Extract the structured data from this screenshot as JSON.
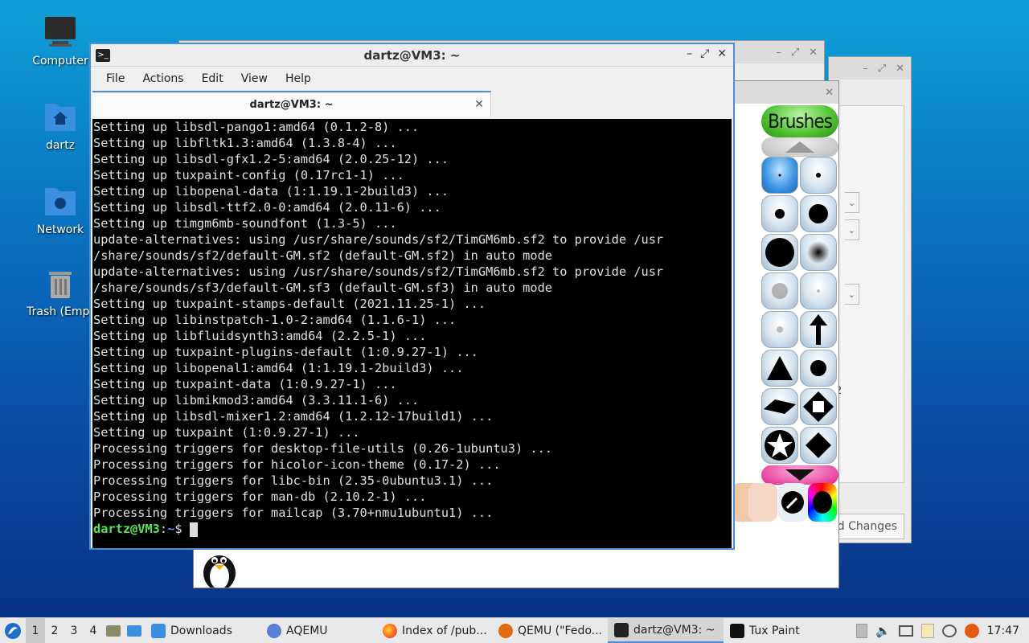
{
  "desktop": {
    "icons": [
      {
        "label": "Computer"
      },
      {
        "label": "dartz"
      },
      {
        "label": "Network"
      },
      {
        "label": "Trash (Empt"
      }
    ]
  },
  "background_window": {
    "button_label_fragment": "rd Changes",
    "digit_fragment": "2"
  },
  "tuxpaint": {
    "title": "Tux Paint",
    "brushes_label": "Brushes"
  },
  "terminal": {
    "title": "dartz@VM3: ~",
    "menu": [
      "File",
      "Actions",
      "Edit",
      "View",
      "Help"
    ],
    "tab_label": "dartz@VM3: ~",
    "lines": [
      "Setting up libsdl-pango1:amd64 (0.1.2-8) ...",
      "Setting up libfltk1.3:amd64 (1.3.8-4) ...",
      "Setting up libsdl-gfx1.2-5:amd64 (2.0.25-12) ...",
      "Setting up tuxpaint-config (0.17rc1-1) ...",
      "Setting up libopenal-data (1:1.19.1-2build3) ...",
      "Setting up libsdl-ttf2.0-0:amd64 (2.0.11-6) ...",
      "Setting up timgm6mb-soundfont (1.3-5) ...",
      "update-alternatives: using /usr/share/sounds/sf2/TimGM6mb.sf2 to provide /usr",
      "/share/sounds/sf2/default-GM.sf2 (default-GM.sf2) in auto mode",
      "update-alternatives: using /usr/share/sounds/sf2/TimGM6mb.sf2 to provide /usr",
      "/share/sounds/sf3/default-GM.sf3 (default-GM.sf3) in auto mode",
      "Setting up tuxpaint-stamps-default (2021.11.25-1) ...",
      "Setting up libinstpatch-1.0-2:amd64 (1.1.6-1) ...",
      "Setting up libfluidsynth3:amd64 (2.2.5-1) ...",
      "Setting up tuxpaint-plugins-default (1:0.9.27-1) ...",
      "Setting up libopenal1:amd64 (1:1.19.1-2build3) ...",
      "Setting up tuxpaint-data (1:0.9.27-1) ...",
      "Setting up libmikmod3:amd64 (3.3.11.1-6) ...",
      "Setting up libsdl-mixer1.2:amd64 (1.2.12-17build1) ...",
      "Setting up tuxpaint (1:0.9.27-1) ...",
      "Processing triggers for desktop-file-utils (0.26-1ubuntu3) ...",
      "Processing triggers for hicolor-icon-theme (0.17-2) ...",
      "Processing triggers for libc-bin (2.35-0ubuntu3.1) ...",
      "Processing triggers for man-db (2.10.2-1) ...",
      "Processing triggers for mailcap (3.70+nmu1ubuntu1) ..."
    ],
    "prompt_user": "dartz@VM3",
    "prompt_sep": ":",
    "prompt_path": "~",
    "prompt_symbol": "$"
  },
  "taskbar": {
    "workspaces": [
      "1",
      "2",
      "3",
      "4"
    ],
    "tasks": [
      {
        "label": "Downloads",
        "icon": "folder-icon"
      },
      {
        "label": "AQEMU",
        "icon": "aqemu-icon"
      },
      {
        "label": "Index of /pub...",
        "icon": "firefox-icon"
      },
      {
        "label": "QEMU (\"Fedo...",
        "icon": "qemu-icon"
      },
      {
        "label": "dartz@VM3: ~",
        "icon": "terminal-icon"
      },
      {
        "label": "Tux Paint",
        "icon": "tuxpaint-icon"
      }
    ],
    "clock": "17:47"
  },
  "colors": {
    "accent": "#4a8fd6",
    "prompt_user": "#4fe84f",
    "prompt_path": "#5c8cff",
    "terminal_bg": "#000000"
  }
}
